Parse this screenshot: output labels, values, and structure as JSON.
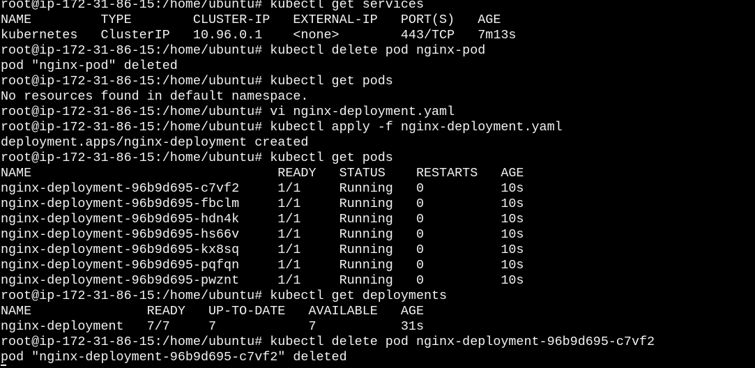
{
  "terminal": {
    "lines": [
      "root@ip-172-31-86-15:/home/ubuntu# kubectl get services",
      "NAME         TYPE        CLUSTER-IP   EXTERNAL-IP   PORT(S)   AGE",
      "kubernetes   ClusterIP   10.96.0.1    <none>        443/TCP   7m13s",
      "root@ip-172-31-86-15:/home/ubuntu# kubectl delete pod nginx-pod",
      "pod \"nginx-pod\" deleted",
      "root@ip-172-31-86-15:/home/ubuntu# kubectl get pods",
      "No resources found in default namespace.",
      "root@ip-172-31-86-15:/home/ubuntu# vi nginx-deployment.yaml",
      "root@ip-172-31-86-15:/home/ubuntu# kubectl apply -f nginx-deployment.yaml",
      "deployment.apps/nginx-deployment created",
      "root@ip-172-31-86-15:/home/ubuntu# kubectl get pods",
      "NAME                                READY   STATUS    RESTARTS   AGE",
      "nginx-deployment-96b9d695-c7vf2     1/1     Running   0          10s",
      "nginx-deployment-96b9d695-fbclm     1/1     Running   0          10s",
      "nginx-deployment-96b9d695-hdn4k     1/1     Running   0          10s",
      "nginx-deployment-96b9d695-hs66v     1/1     Running   0          10s",
      "nginx-deployment-96b9d695-kx8sq     1/1     Running   0          10s",
      "nginx-deployment-96b9d695-pqfqn     1/1     Running   0          10s",
      "nginx-deployment-96b9d695-pwznt     1/1     Running   0          10s",
      "root@ip-172-31-86-15:/home/ubuntu# kubectl get deployments",
      "NAME               READY   UP-TO-DATE   AVAILABLE   AGE",
      "nginx-deployment   7/7     7            7           31s",
      "root@ip-172-31-86-15:/home/ubuntu# kubectl delete pod nginx-deployment-96b9d695-c7vf2",
      "pod \"nginx-deployment-96b9d695-c7vf2\" deleted"
    ],
    "colors": {
      "background": "#000000",
      "foreground": "#f2f2f2"
    }
  }
}
